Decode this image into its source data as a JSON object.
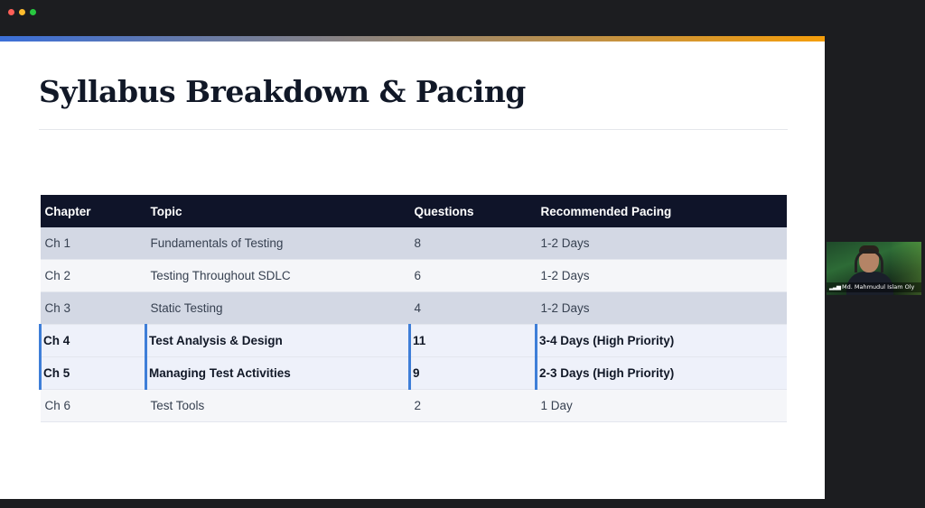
{
  "window": {
    "controls": [
      "close",
      "minimize",
      "maximize"
    ]
  },
  "slide": {
    "title": "Syllabus Breakdown & Pacing",
    "accent_gradient": [
      "#3b6fd8",
      "#f59e0b"
    ],
    "table": {
      "headers": [
        "Chapter",
        "Topic",
        "Questions",
        "Recommended Pacing"
      ],
      "rows": [
        {
          "chapter": "Ch 1",
          "topic": "Fundamentals of Testing",
          "questions": "8",
          "pacing": "1-2 Days",
          "style": "shade"
        },
        {
          "chapter": "Ch 2",
          "topic": "Testing Throughout SDLC",
          "questions": "6",
          "pacing": "1-2 Days",
          "style": "light"
        },
        {
          "chapter": "Ch 3",
          "topic": "Static Testing",
          "questions": "4",
          "pacing": "1-2 Days",
          "style": "shade"
        },
        {
          "chapter": "Ch 4",
          "topic": "Test Analysis & Design",
          "questions": "11",
          "pacing": "3-4 Days (High Priority)",
          "style": "hi"
        },
        {
          "chapter": "Ch 5",
          "topic": "Managing Test Activities",
          "questions": "9",
          "pacing": "2-3 Days (High Priority)",
          "style": "hi"
        },
        {
          "chapter": "Ch 6",
          "topic": "Test Tools",
          "questions": "2",
          "pacing": "1 Day",
          "style": "light"
        }
      ]
    }
  },
  "video_tile": {
    "name": "Md. Mahmudul Islam Oly",
    "signal_icon": "signal-bars-icon"
  }
}
